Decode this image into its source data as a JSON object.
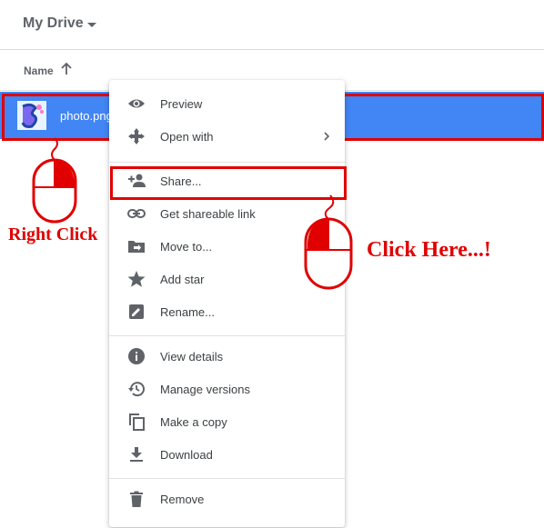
{
  "header": {
    "title": "My Drive"
  },
  "columns": {
    "name": "Name"
  },
  "file": {
    "name": "photo.png"
  },
  "menu": {
    "items": [
      {
        "label": "Preview"
      },
      {
        "label": "Open with"
      },
      {
        "label": "Share..."
      },
      {
        "label": "Get shareable link"
      },
      {
        "label": "Move to..."
      },
      {
        "label": "Add star"
      },
      {
        "label": "Rename..."
      },
      {
        "label": "View details"
      },
      {
        "label": "Manage versions"
      },
      {
        "label": "Make a copy"
      },
      {
        "label": "Download"
      },
      {
        "label": "Remove"
      }
    ]
  },
  "annotations": {
    "right_click": "Right Click",
    "click_here": "Click Here...!"
  },
  "colors": {
    "accent": "#4285f4",
    "highlight": "#e00000"
  }
}
